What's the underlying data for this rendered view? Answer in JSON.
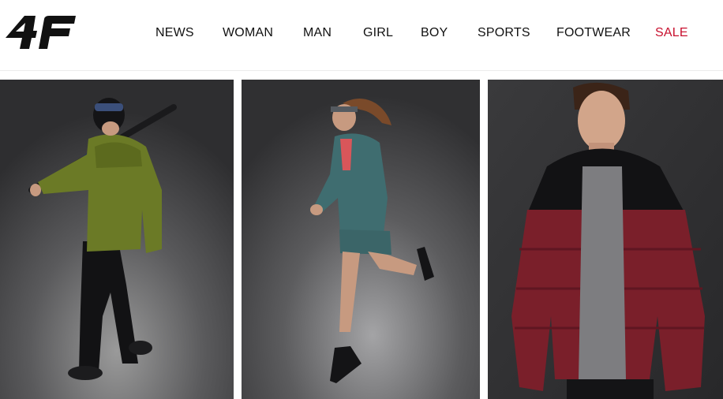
{
  "brand": {
    "logo_text": "4F",
    "icon": "4f-logo-icon"
  },
  "nav": {
    "items": [
      {
        "label": "NEWS"
      },
      {
        "label": "WOMAN"
      },
      {
        "label": "MAN"
      },
      {
        "label": "GIRL"
      },
      {
        "label": "BOY"
      },
      {
        "label": "SPORTS"
      },
      {
        "label": "FOOTWEAR"
      },
      {
        "label": "SALE",
        "color": "#c8102e"
      }
    ]
  },
  "tiles": [
    {
      "name": "skier-green-puffer-jacket",
      "icon": "skier-photo"
    },
    {
      "name": "runner-teal-jacket",
      "icon": "runner-photo"
    },
    {
      "name": "man-burgundy-puffer-jacket",
      "icon": "man-jacket-photo"
    }
  ],
  "colors": {
    "background": "#ffffff",
    "text": "#111111",
    "sale": "#c8102e",
    "photo_backdrop": "#3a3a3c"
  }
}
